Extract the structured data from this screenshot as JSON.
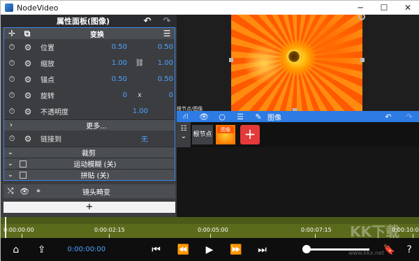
{
  "app": {
    "title": "NodeVideo"
  },
  "panel": {
    "title": "属性面板(图像)",
    "section_title": "变换",
    "rows": [
      {
        "label": "位置",
        "v1": "0.50",
        "mid": "",
        "v2": "0.50"
      },
      {
        "label": "缩放",
        "v1": "1.00",
        "mid": "⛓",
        "v2": "1.00"
      },
      {
        "label": "锚点",
        "v1": "0.50",
        "mid": "",
        "v2": "0.50"
      },
      {
        "label": "旋转",
        "v1": "0",
        "mid": "x",
        "v2": "0"
      }
    ],
    "opacity_label": "不透明度",
    "opacity_value": "1.00",
    "more": "更多...",
    "link_label": "链接到",
    "link_value": "无",
    "sub_sections": [
      "裁剪",
      "运动模糊 (关)",
      "拼贴 (关)"
    ],
    "lens": "镜头畸变",
    "add": "+"
  },
  "node_toolbar": {
    "breadcrumb": "根节点/图像",
    "image_label": "图像"
  },
  "nodes": {
    "root": "根节点",
    "image": "图像",
    "add": "+"
  },
  "timeline": {
    "labels": [
      "0:00:00:00",
      "0:00:02:15",
      "0:00:05:00",
      "0:00:07:15",
      "0:00:10:00"
    ],
    "current_time": "0:00:00:00",
    "zoom_level": 0.05
  },
  "watermark": {
    "big": "KK下载",
    "small": "www.kkx.net"
  }
}
